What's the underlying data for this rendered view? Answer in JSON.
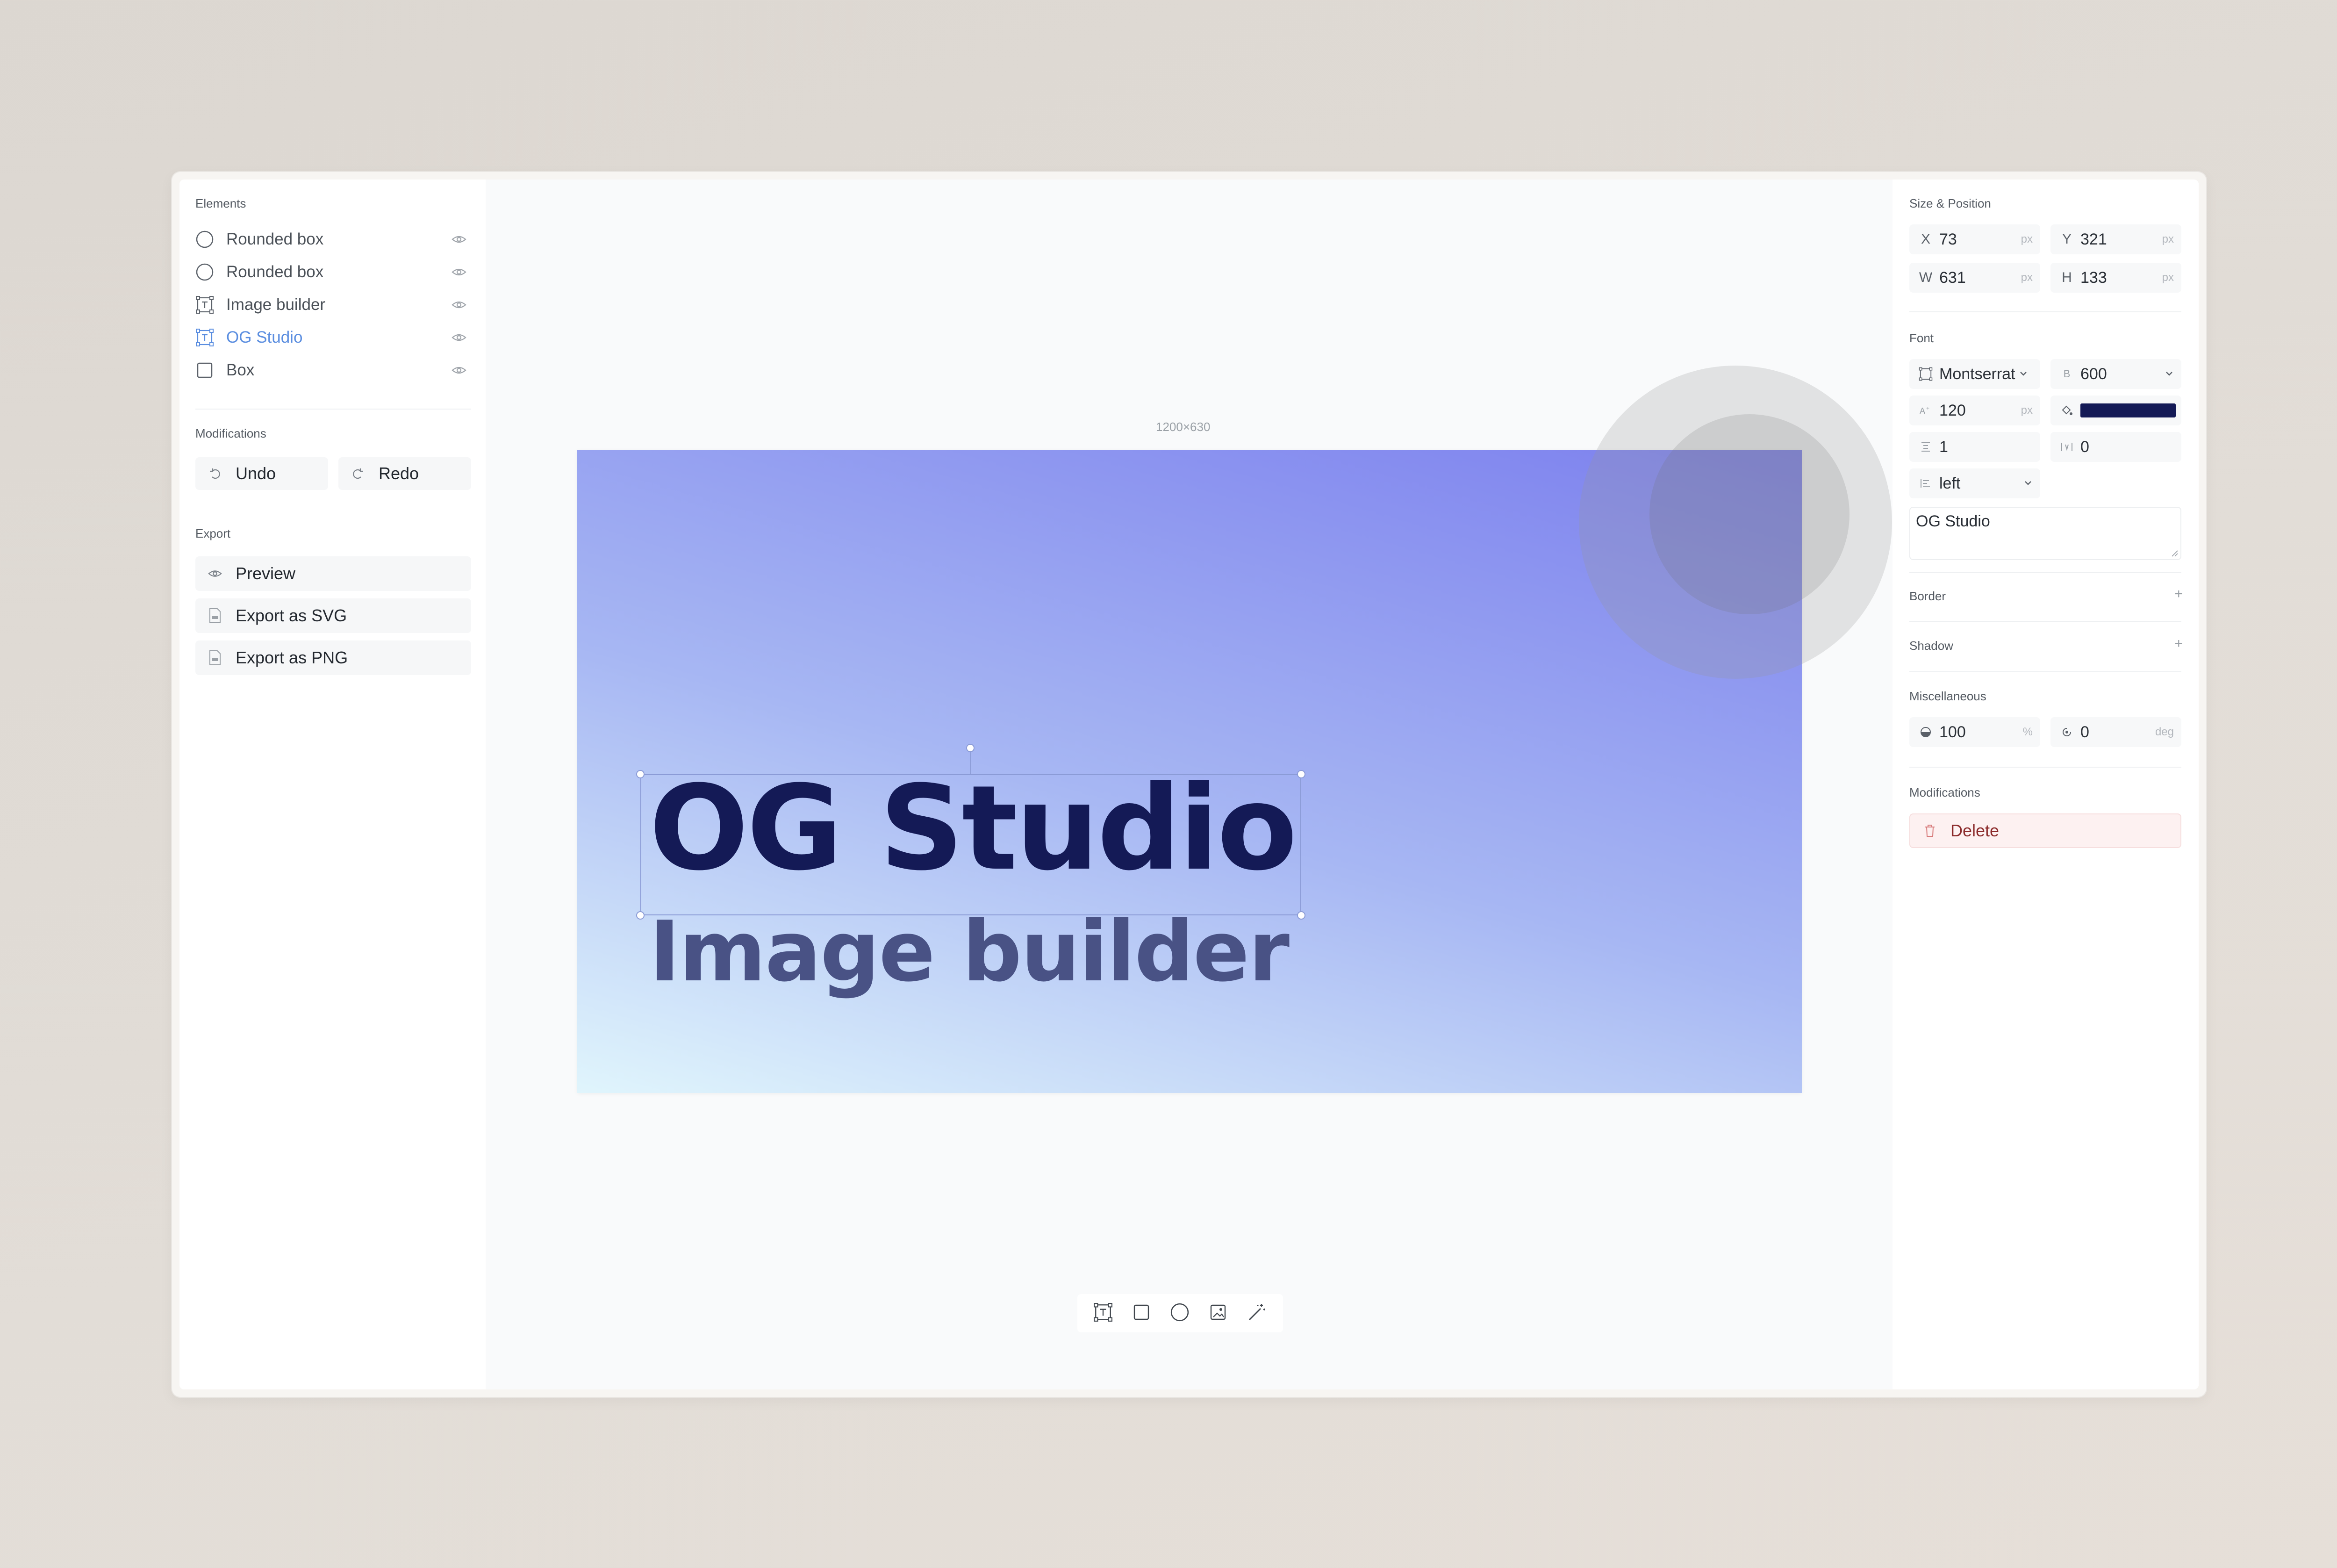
{
  "elements": {
    "title": "Elements",
    "items": [
      {
        "label": "Rounded box",
        "icon": "circle-icon"
      },
      {
        "label": "Rounded box",
        "icon": "circle-icon"
      },
      {
        "label": "Image builder",
        "icon": "text-frame-icon"
      },
      {
        "label": "OG Studio",
        "icon": "text-frame-icon",
        "active": true
      },
      {
        "label": "Box",
        "icon": "square-icon"
      }
    ]
  },
  "modifications": {
    "title": "Modifications",
    "undo_label": "Undo",
    "redo_label": "Redo"
  },
  "export": {
    "title": "Export",
    "preview_label": "Preview",
    "svg_label": "Export as SVG",
    "png_label": "Export as PNG"
  },
  "canvas": {
    "size_label": "1200×630",
    "title_text": "OG Studio",
    "subtitle_text": "Image builder",
    "gradient_colors": [
      "#e0f5fc",
      "#a7b7f3",
      "#7c80ee"
    ],
    "title_color": "#141a56",
    "subtitle_color": "#495285"
  },
  "toolbar": {
    "tools": [
      "text-frame-icon",
      "square-icon",
      "circle-icon",
      "image-icon",
      "magic-wand-icon"
    ]
  },
  "inspector": {
    "size_position": {
      "title": "Size & Position",
      "x_label": "X",
      "x": "73",
      "y_label": "Y",
      "y": "321",
      "w_label": "W",
      "w": "631",
      "h_label": "H",
      "h": "133",
      "unit": "px"
    },
    "font": {
      "title": "Font",
      "family": "Montserrat",
      "weight_label": "B",
      "weight": "600",
      "size": "120",
      "size_unit": "px",
      "color": "#141a56",
      "line_height": "1",
      "letter_spacing": "0",
      "align": "left",
      "text": "OG Studio"
    },
    "border": {
      "title": "Border",
      "add": "+"
    },
    "shadow": {
      "title": "Shadow",
      "add": "+"
    },
    "misc": {
      "title": "Miscellaneous",
      "opacity": "100",
      "opacity_unit": "%",
      "rotation": "0",
      "rotation_unit": "deg"
    },
    "modifications": {
      "title": "Modifications",
      "delete_label": "Delete"
    }
  }
}
